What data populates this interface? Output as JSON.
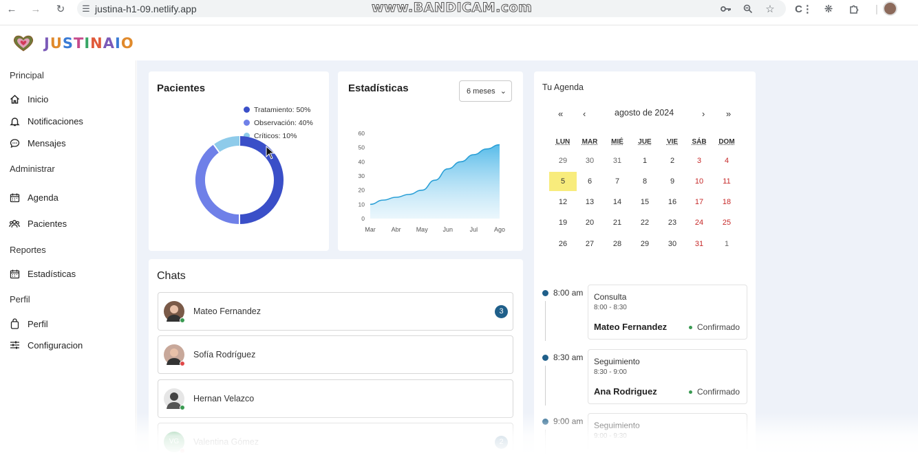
{
  "browser": {
    "url": "justina-h1-09.netlify.app",
    "watermark": "www.BANDICAM.com"
  },
  "app": {
    "logo_text": "JUSTINAIO"
  },
  "sidebar": {
    "sections": [
      {
        "title": "Principal",
        "items": [
          {
            "label": "Inicio",
            "icon": "home-icon"
          },
          {
            "label": "Notificaciones",
            "icon": "bell-icon"
          },
          {
            "label": "Mensajes",
            "icon": "chat-icon"
          }
        ]
      },
      {
        "title": "Administrar",
        "items": [
          {
            "label": "Agenda",
            "icon": "calendar-icon"
          },
          {
            "label": "Pacientes",
            "icon": "users-icon"
          }
        ]
      },
      {
        "title": "Reportes",
        "items": [
          {
            "label": "Estadísticas",
            "icon": "calendar-icon"
          }
        ]
      },
      {
        "title": "Perfil",
        "items": [
          {
            "label": "Perfil",
            "icon": "bag-icon"
          },
          {
            "label": "Configuracion",
            "icon": "sliders-icon"
          }
        ]
      }
    ]
  },
  "patients_card": {
    "title": "Pacientes",
    "legend": [
      "Tratamiento: 50%",
      "Observación: 40%",
      "Críticos: 10%"
    ],
    "colors": [
      "#3a4fc8",
      "#6f80e8",
      "#8ecbea"
    ]
  },
  "stats_card": {
    "title": "Estadísticas",
    "range_select": "6 meses"
  },
  "chart_data": [
    {
      "type": "pie",
      "title": "Pacientes",
      "categories": [
        "Tratamiento",
        "Observación",
        "Críticos"
      ],
      "values": [
        50,
        40,
        10
      ],
      "legend": "top-right"
    },
    {
      "type": "area",
      "title": "Estadísticas",
      "categories": [
        "Mar",
        "Abr",
        "May",
        "Jun",
        "Jul",
        "Ago"
      ],
      "x": [
        "Mar",
        "",
        "Abr",
        "",
        "May",
        "",
        "Jun",
        "",
        "Jul",
        "",
        "Ago"
      ],
      "values": [
        10,
        13,
        15,
        17,
        20,
        27,
        35,
        40,
        45,
        49,
        52
      ],
      "ylim": [
        0,
        60
      ],
      "yticks": [
        "0",
        "10",
        "20",
        "30",
        "40",
        "50",
        "60"
      ],
      "grid": false
    }
  ],
  "chats": {
    "title": "Chats",
    "items": [
      {
        "name": "Mateo Fernandez",
        "badge": "3",
        "status": "#3a9a52"
      },
      {
        "name": "Sofía Rodríguez",
        "badge": "",
        "status": "#e04848"
      },
      {
        "name": "Hernan Velazco",
        "badge": "",
        "status": "#3a9a52"
      },
      {
        "name": "Valentina Gómez",
        "badge": "2",
        "status": "#e04848",
        "initials": "VG"
      }
    ]
  },
  "agenda": {
    "title": "Tu Agenda",
    "month": "agosto de 2024",
    "nav": {
      "first": "«",
      "prev": "‹",
      "next": "›",
      "last": "»"
    },
    "weekdays": [
      "LUN",
      "MAR",
      "MIÉ",
      "JUE",
      "VIE",
      "SÁB",
      "DOM"
    ],
    "weeks": [
      [
        "29",
        "30",
        "31",
        "1",
        "2",
        "3",
        "4"
      ],
      [
        "5",
        "6",
        "7",
        "8",
        "9",
        "10",
        "11"
      ],
      [
        "12",
        "13",
        "14",
        "15",
        "16",
        "17",
        "18"
      ],
      [
        "19",
        "20",
        "21",
        "22",
        "23",
        "24",
        "25"
      ],
      [
        "26",
        "27",
        "28",
        "29",
        "30",
        "31",
        "1"
      ]
    ],
    "today": "5",
    "events": [
      {
        "time": "8:00 am",
        "type": "Consulta",
        "range": "8:00 - 8:30",
        "patient": "Mateo Fernandez",
        "status": "Confirmado"
      },
      {
        "time": "8:30 am",
        "type": "Seguimiento",
        "range": "8:30 - 9:00",
        "patient": "Ana Rodriguez",
        "status": "Confirmado"
      },
      {
        "time": "9:00 am",
        "type": "Seguimiento",
        "range": "9:00 - 9:30",
        "patient": "",
        "status": ""
      }
    ]
  }
}
